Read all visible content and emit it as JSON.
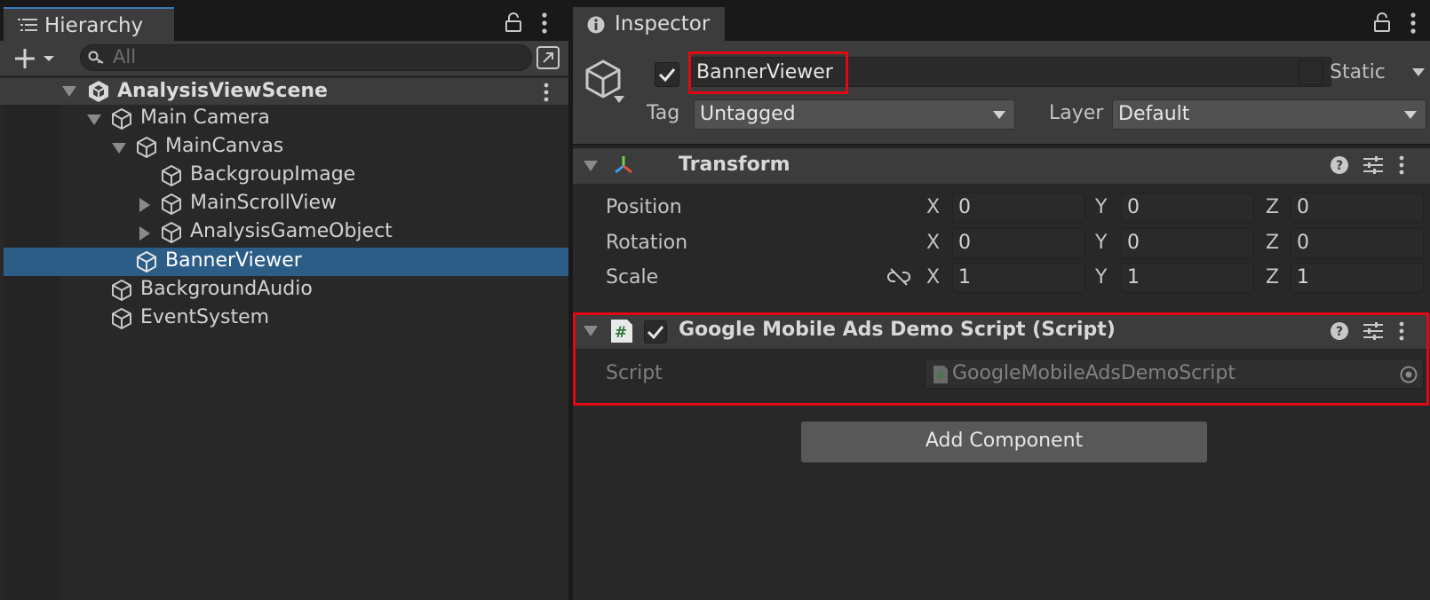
{
  "hierarchy": {
    "tab_label": "Hierarchy",
    "search_placeholder": "All",
    "tree": [
      {
        "label": "AnalysisViewScene"
      },
      {
        "label": "Main Camera"
      },
      {
        "label": "MainCanvas"
      },
      {
        "label": "BackgroupImage"
      },
      {
        "label": "MainScrollView"
      },
      {
        "label": "AnalysisGameObject"
      },
      {
        "label": "BannerViewer"
      },
      {
        "label": "BackgroundAudio"
      },
      {
        "label": "EventSystem"
      }
    ],
    "selected": "BannerViewer"
  },
  "inspector": {
    "tab_label": "Inspector",
    "object_name": "BannerViewer",
    "static_label": "Static",
    "tag_label": "Tag",
    "tag_value": "Untagged",
    "layer_label": "Layer",
    "layer_value": "Default",
    "transform": {
      "title": "Transform",
      "rows": [
        {
          "label": "Position",
          "x": "0",
          "y": "0",
          "z": "0"
        },
        {
          "label": "Rotation",
          "x": "0",
          "y": "0",
          "z": "0"
        },
        {
          "label": "Scale",
          "x": "1",
          "y": "1",
          "z": "1"
        }
      ],
      "axis_x": "X",
      "axis_y": "Y",
      "axis_z": "Z"
    },
    "script_component": {
      "title": "Google Mobile Ads Demo Script (Script)",
      "script_label": "Script",
      "script_value": "GoogleMobileAdsDemoScript"
    },
    "add_component_label": "Add Component"
  },
  "colors": {
    "highlight": "#e30613",
    "selection": "#2c5d87",
    "accent_tab": "#3a79bb"
  }
}
